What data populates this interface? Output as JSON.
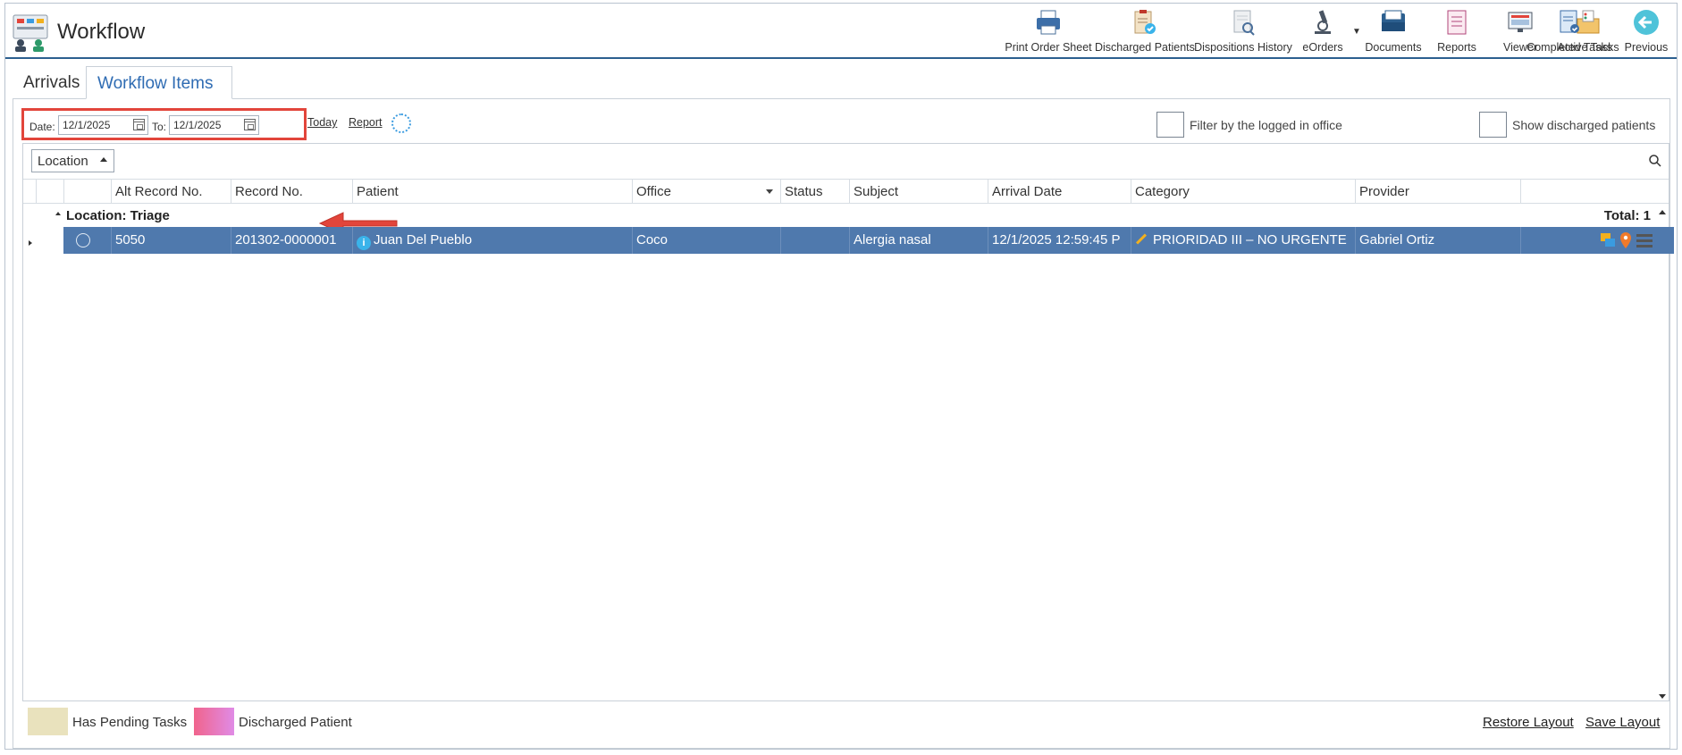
{
  "app": {
    "title": "Workflow"
  },
  "toolbar": {
    "buttons": [
      {
        "label": "Print Order Sheet",
        "icon": "printer-icon"
      },
      {
        "label": "Discharged Patients",
        "icon": "clipboard-check-icon"
      },
      {
        "label": "Dispositions History",
        "icon": "document-search-icon"
      },
      {
        "label": "eOrders",
        "icon": "microscope-icon"
      },
      {
        "label": "Documents",
        "icon": "inbox-tray-icon"
      },
      {
        "label": "Reports",
        "icon": "report-icon"
      },
      {
        "label": "Viewer",
        "icon": "monitor-icon"
      },
      {
        "label": "Active Tasks",
        "icon": "box-tasks-icon"
      },
      {
        "label": "Completed Tasks",
        "icon": "document-check-icon"
      },
      {
        "label": "Previous",
        "icon": "back-arrow-icon"
      }
    ]
  },
  "tabs": [
    {
      "label": "Arrivals",
      "active": false
    },
    {
      "label": "Workflow Items",
      "active": true
    }
  ],
  "filters": {
    "date_label": "Date:",
    "date_value": "12/1/2025",
    "to_label": "To:",
    "to_value": "12/1/2025",
    "obscured_link_1": "Today",
    "obscured_link_2": "Report",
    "office_filter_label": "Filter by the logged in office",
    "discharged_filter_label": "Show discharged patients"
  },
  "grouping": {
    "chip_label": "Location"
  },
  "table": {
    "columns": [
      "Alt Record No.",
      "Record No.",
      "Patient",
      "Office",
      "Status",
      "Subject",
      "Arrival Date",
      "Category",
      "Provider"
    ],
    "group": {
      "label": "Location: Triage",
      "total": "Total: 1"
    },
    "rows": [
      {
        "alt_record_no": "5050",
        "record_no": "201302-0000001",
        "patient": "Juan Del Pueblo",
        "office": "Coco",
        "status": "",
        "subject": "Alergia nasal",
        "arrival_date": "12/1/2025 12:59:45 P",
        "category": "PRIORIDAD III – NO URGENTE",
        "provider": "Gabriel Ortiz"
      }
    ]
  },
  "legend": {
    "pending_label": "Has Pending Tasks",
    "discharged_label": "Discharged Patient",
    "pending_color": "#e9e2bd",
    "discharged_color": "#f0648c"
  },
  "footer": {
    "restore_label": "Restore Layout",
    "save_label": "Save Layout"
  },
  "colors": {
    "accent": "#2f6cb3",
    "selected_row": "#4f79ad",
    "highlight": "#e2453b"
  }
}
